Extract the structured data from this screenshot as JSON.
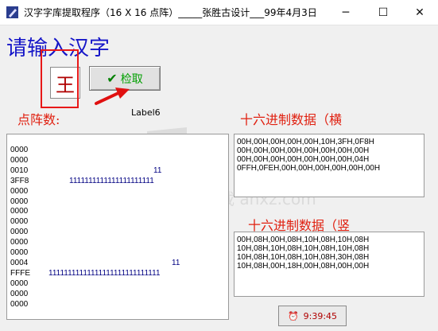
{
  "window": {
    "title": "汉字字库提取程序（16 X 16 点阵）_____张胜古设计___99年4月3日",
    "minimize": "─",
    "maximize": "☐",
    "close": "✕"
  },
  "prompt": "请输入汉字",
  "input_char": "王",
  "check_button": {
    "icon": "✔",
    "label": "检取"
  },
  "matrix_label": "点阵数:",
  "label6": "Label6",
  "hex_h_label": "十六进制数据（横",
  "hex_v_label": "十六进制数据（竖",
  "matrix_rows": [
    {
      "hex": "0000",
      "bits": ""
    },
    {
      "hex": "0000",
      "bits": ""
    },
    {
      "hex": "0010",
      "bits": "11"
    },
    {
      "hex": "3FF8",
      "bits": "1111111111111111111111"
    },
    {
      "hex": "0000",
      "bits": ""
    },
    {
      "hex": "0000",
      "bits": ""
    },
    {
      "hex": "0000",
      "bits": ""
    },
    {
      "hex": "0000",
      "bits": ""
    },
    {
      "hex": "0000",
      "bits": ""
    },
    {
      "hex": "0000",
      "bits": ""
    },
    {
      "hex": "0000",
      "bits": ""
    },
    {
      "hex": "0004",
      "bits": "11"
    },
    {
      "hex": "FFFE",
      "bits": "11111111111111111111111111111"
    },
    {
      "hex": "0000",
      "bits": ""
    },
    {
      "hex": "0000",
      "bits": ""
    },
    {
      "hex": "0000",
      "bits": ""
    }
  ],
  "hex_h_lines": [
    "00H,00H,00H,00H,00H,10H,3FH,0F8H",
    "00H,00H,00H,00H,00H,00H,00H,00H",
    "00H,00H,00H,00H,00H,00H,00H,04H",
    "0FFH,0FEH,00H,00H,00H,00H,00H,00H"
  ],
  "hex_v_lines": [
    "00H,08H,00H,08H,10H,08H,10H,08H",
    "10H,08H,10H,08H,10H,08H,10H,08H",
    "10H,08H,10H,08H,10H,08H,30H,08H",
    "10H,08H,00H,18H,00H,08H,00H,00H"
  ],
  "time_label": "9:39:45",
  "watermark": "安下载 anxz.com"
}
